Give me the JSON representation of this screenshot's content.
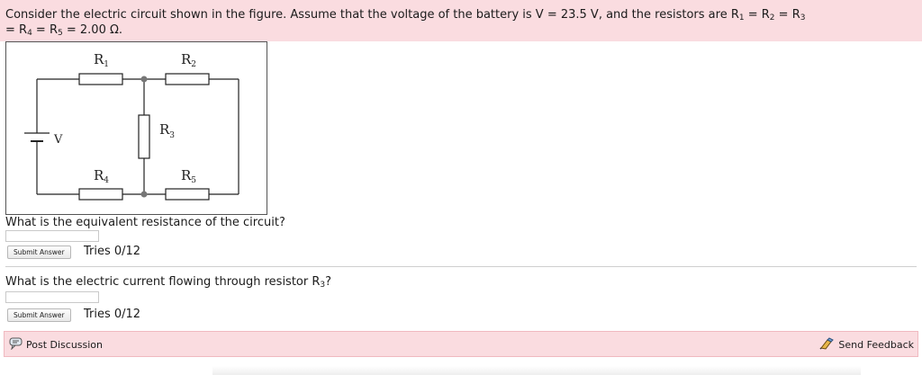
{
  "problem": {
    "line1_pre": "Consider the electric circuit shown in the figure. Assume that the voltage of the battery is V = 23.5 V, and the resistors are R",
    "s1": "1",
    "eq1": " = R",
    "s2": "2",
    "eq2": " = R",
    "s3": "3",
    "line2_pre": "= R",
    "s4": "4",
    "eq4": " = R",
    "s5": "5",
    "value": " = 2.00 Ω."
  },
  "circuit": {
    "r1": "R",
    "r1_sub": "1",
    "r2": "R",
    "r2_sub": "2",
    "r3": "R",
    "r3_sub": "3",
    "r4": "R",
    "r4_sub": "4",
    "r5": "R",
    "r5_sub": "5",
    "v": "V"
  },
  "questions": [
    {
      "text": "What is the equivalent resistance of the circuit?",
      "submit_label": "Submit Answer",
      "tries": "Tries 0/12"
    },
    {
      "text_pre": "What is the electric current flowing through resistor R",
      "text_sub": "3",
      "text_post": "?",
      "submit_label": "Submit Answer",
      "tries": "Tries 0/12"
    }
  ],
  "footer": {
    "post_discussion": "Post Discussion",
    "send_feedback": "Send Feedback"
  },
  "icons": {
    "post_discussion": "discussion-icon",
    "send_feedback": "feedback-icon"
  },
  "colors": {
    "banner_bg": "#fadce0",
    "footer_border": "#f0b9c0"
  }
}
